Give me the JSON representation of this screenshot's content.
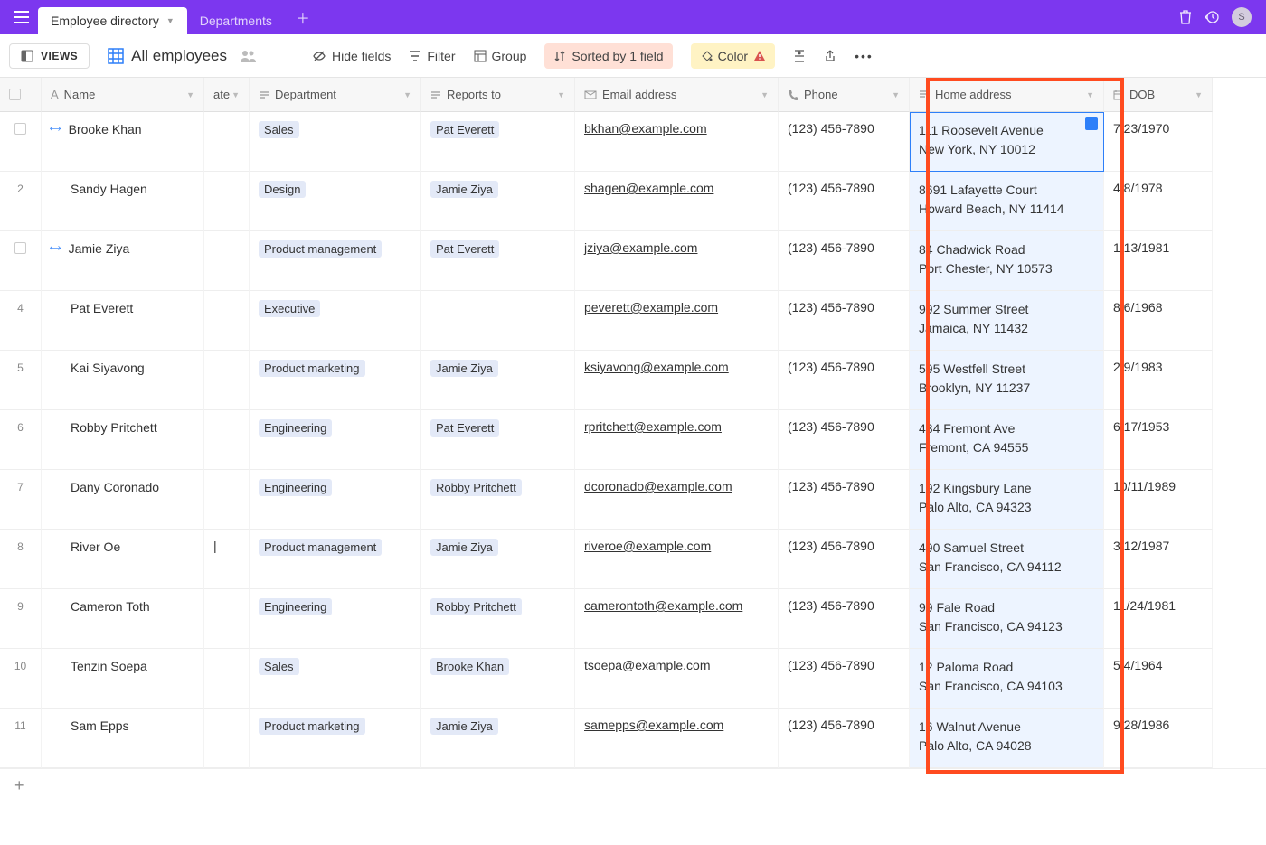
{
  "topbar": {
    "tabs": [
      {
        "label": "Employee directory",
        "active": true
      },
      {
        "label": "Departments",
        "active": false
      }
    ]
  },
  "toolbar": {
    "views_label": "VIEWS",
    "view_name": "All employees",
    "hide_fields": "Hide fields",
    "filter": "Filter",
    "group": "Group",
    "sorted": "Sorted by 1 field",
    "color": "Color"
  },
  "columns": {
    "name": "Name",
    "date_frag": "ate",
    "department": "Department",
    "reports_to": "Reports to",
    "email": "Email address",
    "phone": "Phone",
    "address": "Home address",
    "dob": "DOB"
  },
  "highlighted_column": "address",
  "rows": [
    {
      "num": "",
      "checkbox": true,
      "expand": true,
      "name": "Brooke Khan",
      "department": "Sales",
      "reports_to": "Pat Everett",
      "email": "bkhan@example.com",
      "phone": "(123) 456-7890",
      "addr1": "111 Roosevelt Avenue",
      "addr2": "New York, NY 10012",
      "dob": "7/23/1970",
      "editing": true
    },
    {
      "num": "2",
      "name": "Sandy Hagen",
      "department": "Design",
      "reports_to": "Jamie Ziya",
      "email": "shagen@example.com",
      "phone": "(123) 456-7890",
      "addr1": "8691 Lafayette Court",
      "addr2": "Howard Beach, NY 11414",
      "dob": "4/8/1978"
    },
    {
      "num": "",
      "checkbox": true,
      "expand": true,
      "name": "Jamie Ziya",
      "department": "Product management",
      "reports_to": "Pat Everett",
      "email": "jziya@example.com",
      "phone": "(123) 456-7890",
      "addr1": "84 Chadwick Road",
      "addr2": "Port Chester, NY 10573",
      "dob": "1/13/1981"
    },
    {
      "num": "4",
      "name": "Pat Everett",
      "department": "Executive",
      "reports_to": "",
      "email": "peverett@example.com",
      "phone": "(123) 456-7890",
      "addr1": "992 Summer Street",
      "addr2": "Jamaica, NY 11432",
      "dob": "8/6/1968"
    },
    {
      "num": "5",
      "name": "Kai Siyavong",
      "department": "Product marketing",
      "reports_to": "Jamie Ziya",
      "email": "ksiyavong@example.com",
      "phone": "(123) 456-7890",
      "addr1": "595 Westfell Street",
      "addr2": "Brooklyn, NY 11237",
      "dob": "2/9/1983"
    },
    {
      "num": "6",
      "name": "Robby Pritchett",
      "department": "Engineering",
      "reports_to": "Pat Everett",
      "email": "rpritchett@example.com",
      "phone": "(123) 456-7890",
      "addr1": "434 Fremont Ave",
      "addr2": "Fremont, CA 94555",
      "dob": "6/17/1953"
    },
    {
      "num": "7",
      "name": "Dany Coronado",
      "department": "Engineering",
      "reports_to": "Robby Pritchett",
      "email": "dcoronado@example.com",
      "phone": "(123) 456-7890",
      "addr1": "192 Kingsbury Lane",
      "addr2": "Palo Alto, CA 94323",
      "dob": "10/11/1989"
    },
    {
      "num": "8",
      "name": "River Oe",
      "date_frag": "|",
      "department": "Product management",
      "reports_to": "Jamie Ziya",
      "email": "riveroe@example.com",
      "phone": "(123) 456-7890",
      "addr1": "490 Samuel Street",
      "addr2": "San Francisco, CA 94112",
      "dob": "3/12/1987"
    },
    {
      "num": "9",
      "name": "Cameron Toth",
      "department": "Engineering",
      "reports_to": "Robby Pritchett",
      "email": "camerontoth@example.com",
      "phone": "(123) 456-7890",
      "addr1": "99 Fale Road",
      "addr2": "San Francisco, CA 94123",
      "dob": "11/24/1981"
    },
    {
      "num": "10",
      "name": "Tenzin Soepa",
      "department": "Sales",
      "reports_to": "Brooke Khan",
      "email": "tsoepa@example.com",
      "phone": "(123) 456-7890",
      "addr1": "12 Paloma Road",
      "addr2": "San Francisco, CA 94103",
      "dob": "5/4/1964"
    },
    {
      "num": "11",
      "name": "Sam Epps",
      "department": "Product marketing",
      "reports_to": "Jamie Ziya",
      "email": "samepps@example.com",
      "phone": "(123) 456-7890",
      "addr1": "16 Walnut Avenue",
      "addr2": "Palo Alto, CA 94028",
      "dob": "9/28/1986"
    }
  ]
}
